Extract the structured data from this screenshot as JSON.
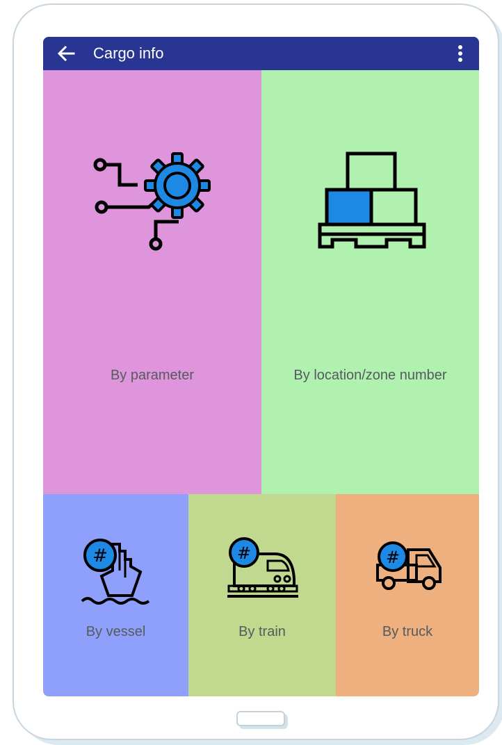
{
  "appbar": {
    "title": "Cargo info",
    "back_icon": "arrow-left-icon",
    "menu_icon": "more-vertical-icon"
  },
  "tiles": {
    "parameter": {
      "label": "By parameter",
      "icon": "parameter-gear-icon"
    },
    "location": {
      "label": "By location/zone number",
      "icon": "pallet-boxes-icon"
    },
    "vessel": {
      "label": "By vessel",
      "icon": "vessel-icon"
    },
    "train": {
      "label": "By train",
      "icon": "train-icon"
    },
    "truck": {
      "label": "By truck",
      "icon": "truck-icon"
    }
  },
  "colors": {
    "appbar": "#283593",
    "parameter": "#df95dc",
    "location": "#b1f1b0",
    "vessel": "#8ea0fb",
    "train": "#c0d98e",
    "truck": "#eeb07e",
    "icon_accent": "#1e88e5"
  }
}
